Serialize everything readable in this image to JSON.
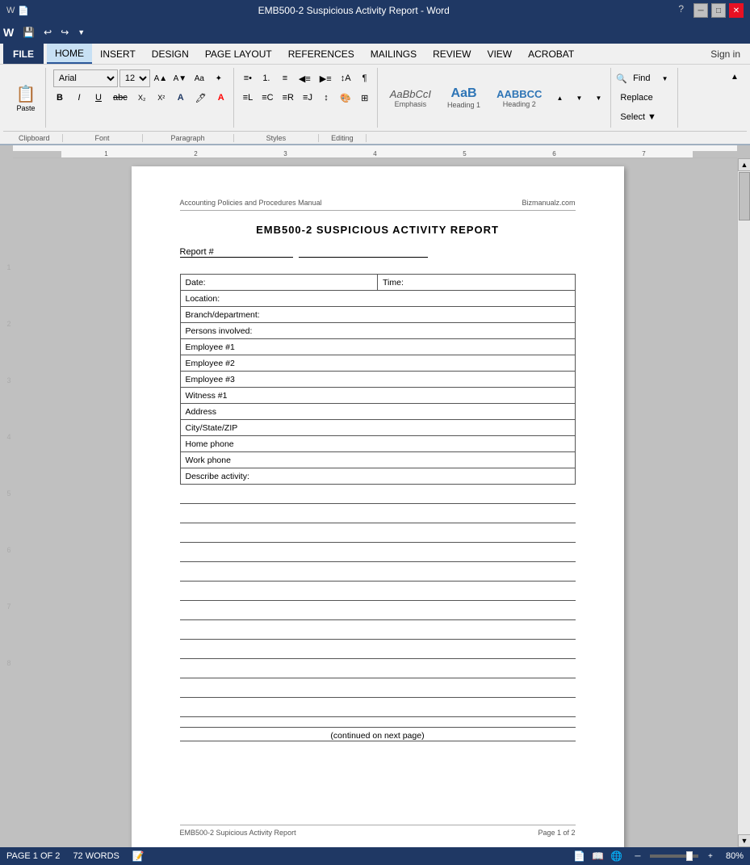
{
  "titlebar": {
    "title": "EMB500-2 Suspicious Activity Report - Word",
    "help_icon": "?",
    "minimize": "─",
    "restore": "□",
    "close": "✕"
  },
  "quickaccess": {
    "save_label": "💾",
    "undo_label": "↩",
    "redo_label": "↪",
    "customize_label": "▼"
  },
  "menubar": {
    "items": [
      "HOME",
      "INSERT",
      "DESIGN",
      "PAGE LAYOUT",
      "REFERENCES",
      "MAILINGS",
      "REVIEW",
      "VIEW",
      "ACROBAT"
    ],
    "active": "HOME",
    "sign_in": "Sign in"
  },
  "ribbon": {
    "clipboard_label": "Clipboard",
    "font_label": "Font",
    "paragraph_label": "Paragraph",
    "styles_label": "Styles",
    "editing_label": "Editing",
    "font_name": "Arial",
    "font_size": "12",
    "paste_label": "Paste",
    "find_label": "Find",
    "replace_label": "Replace",
    "select_label": "Select ▼",
    "style_emphasis": "Emphasis",
    "style_heading1": "Heading 1",
    "style_heading2": "Heading 2"
  },
  "document": {
    "header_left": "Accounting Policies and Procedures Manual",
    "header_right": "Bizmanualz.com",
    "title": "EMB500-2 SUSPICIOUS ACTIVITY REPORT",
    "report_label": "Report #",
    "form_rows": [
      {
        "label": "Date:",
        "value": "",
        "extra_label": "Time:",
        "extra_value": "",
        "two_col": true
      },
      {
        "label": "Location:",
        "value": ""
      },
      {
        "label": "Branch/department:",
        "value": ""
      },
      {
        "label": "Persons involved:",
        "value": ""
      },
      {
        "label": "Employee #1",
        "value": ""
      },
      {
        "label": "Employee #2",
        "value": ""
      },
      {
        "label": "Employee #3",
        "value": ""
      },
      {
        "label": "Witness #1",
        "value": ""
      },
      {
        "label": "Address",
        "value": ""
      },
      {
        "label": "City/State/ZIP",
        "value": ""
      },
      {
        "label": "Home phone",
        "value": ""
      },
      {
        "label": "Work phone",
        "value": ""
      },
      {
        "label": "Describe activity:",
        "value": ""
      }
    ],
    "activity_lines": 12,
    "continued_text": "(continued on next page)",
    "footer_left": "EMB500-2 Supicious Activity Report",
    "footer_right": "Page 1 of 2"
  },
  "statusbar": {
    "page_info": "PAGE 1 OF 2",
    "word_count": "72 WORDS",
    "zoom_level": "80%"
  },
  "ruler": {
    "marks": [
      "1",
      "2",
      "3",
      "4",
      "5",
      "6",
      "7"
    ]
  }
}
